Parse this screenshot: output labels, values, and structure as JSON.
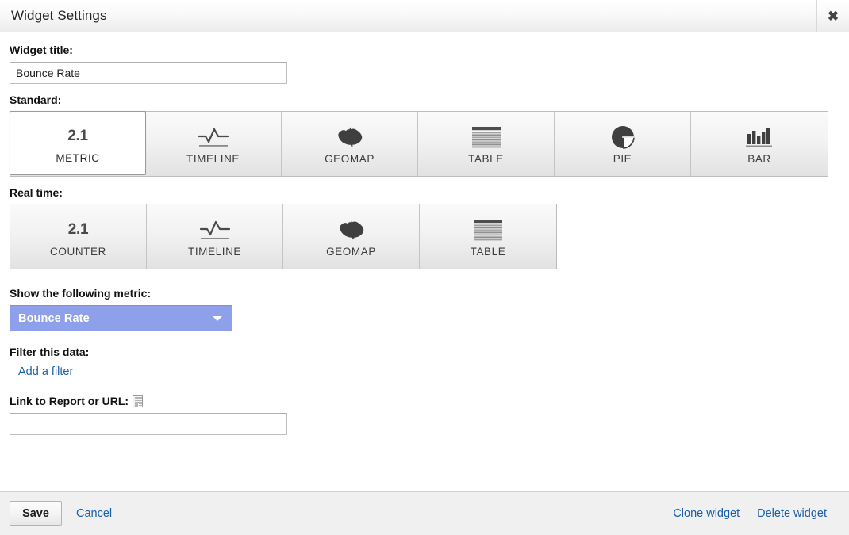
{
  "window": {
    "title": "Widget Settings",
    "close_icon": "close-icon"
  },
  "form": {
    "widget_title_label": "Widget title:",
    "widget_title_value": "Bounce Rate",
    "widget_title_placeholder": "",
    "standard_label": "Standard:",
    "realtime_label": "Real time:",
    "metric_label": "Show the following metric:",
    "metric_value": "Bounce Rate",
    "filter_label": "Filter this data:",
    "add_filter_link": "Add a filter",
    "link_label": "Link to Report or URL:",
    "link_value": "",
    "link_placeholder": "",
    "report_icon": "report-thumbnail-icon"
  },
  "standard_tiles": [
    {
      "label": "METRIC",
      "icon": "metric-number-icon",
      "glyph": "2.1",
      "selected": true
    },
    {
      "label": "TIMELINE",
      "icon": "timeline-icon",
      "glyph": "",
      "selected": false
    },
    {
      "label": "GEOMAP",
      "icon": "geomap-icon",
      "glyph": "",
      "selected": false
    },
    {
      "label": "TABLE",
      "icon": "table-icon",
      "glyph": "",
      "selected": false
    },
    {
      "label": "PIE",
      "icon": "pie-chart-icon",
      "glyph": "",
      "selected": false
    },
    {
      "label": "BAR",
      "icon": "bar-chart-icon",
      "glyph": "",
      "selected": false
    }
  ],
  "realtime_tiles": [
    {
      "label": "COUNTER",
      "icon": "counter-number-icon",
      "glyph": "2.1",
      "selected": false
    },
    {
      "label": "TIMELINE",
      "icon": "timeline-icon",
      "glyph": "",
      "selected": false
    },
    {
      "label": "GEOMAP",
      "icon": "geomap-icon",
      "glyph": "",
      "selected": false
    },
    {
      "label": "TABLE",
      "icon": "table-icon",
      "glyph": "",
      "selected": false
    }
  ],
  "footer": {
    "save_label": "Save",
    "cancel_label": "Cancel",
    "clone_label": "Clone widget",
    "delete_label": "Delete widget"
  },
  "colors": {
    "dropdown_bg": "#8fa0ea",
    "link_blue": "#1a5fa8",
    "header_border": "#cfcfcf",
    "footer_bg": "#f0f0f0",
    "icon_dark": "#4a4a4a"
  }
}
